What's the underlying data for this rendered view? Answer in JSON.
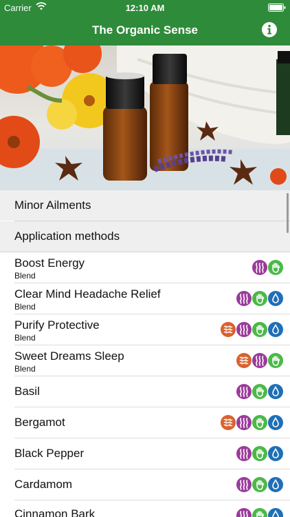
{
  "status": {
    "carrier": "Carrier",
    "time": "12:10 AM"
  },
  "nav": {
    "title": "The Organic Sense"
  },
  "sections": [
    {
      "label": "Minor Ailments"
    },
    {
      "label": "Application methods"
    }
  ],
  "items": [
    {
      "name": "Boost Energy",
      "subtitle": "Blend",
      "methods": [
        "aromatic",
        "topical"
      ]
    },
    {
      "name": "Clear Mind Headache Relief",
      "subtitle": "Blend",
      "methods": [
        "aromatic",
        "topical",
        "internal"
      ]
    },
    {
      "name": "Purify Protective",
      "subtitle": "Blend",
      "methods": [
        "dilute",
        "aromatic",
        "topical",
        "internal"
      ]
    },
    {
      "name": "Sweet Dreams Sleep",
      "subtitle": "Blend",
      "methods": [
        "dilute",
        "aromatic",
        "topical"
      ]
    },
    {
      "name": "Basil",
      "subtitle": "",
      "methods": [
        "aromatic",
        "topical",
        "internal"
      ]
    },
    {
      "name": "Bergamot",
      "subtitle": "",
      "methods": [
        "dilute",
        "aromatic",
        "topical",
        "internal"
      ]
    },
    {
      "name": "Black Pepper",
      "subtitle": "",
      "methods": [
        "aromatic",
        "topical",
        "internal"
      ]
    },
    {
      "name": "Cardamom",
      "subtitle": "",
      "methods": [
        "aromatic",
        "topical",
        "internal"
      ]
    },
    {
      "name": "Cinnamon Bark",
      "subtitle": "",
      "methods": [
        "aromatic",
        "topical",
        "internal"
      ]
    }
  ],
  "icons": {
    "aromatic": {
      "name": "aromatic-waves-icon",
      "color": "#9b3a9b"
    },
    "topical": {
      "name": "hand-icon",
      "color": "#4cb848"
    },
    "internal": {
      "name": "droplet-icon",
      "color": "#1f6fb5"
    },
    "dilute": {
      "name": "dilute-pattern-icon",
      "color": "#d8622d"
    }
  },
  "colors": {
    "brand": "#2e8b3a",
    "section_bg": "#efefef"
  }
}
